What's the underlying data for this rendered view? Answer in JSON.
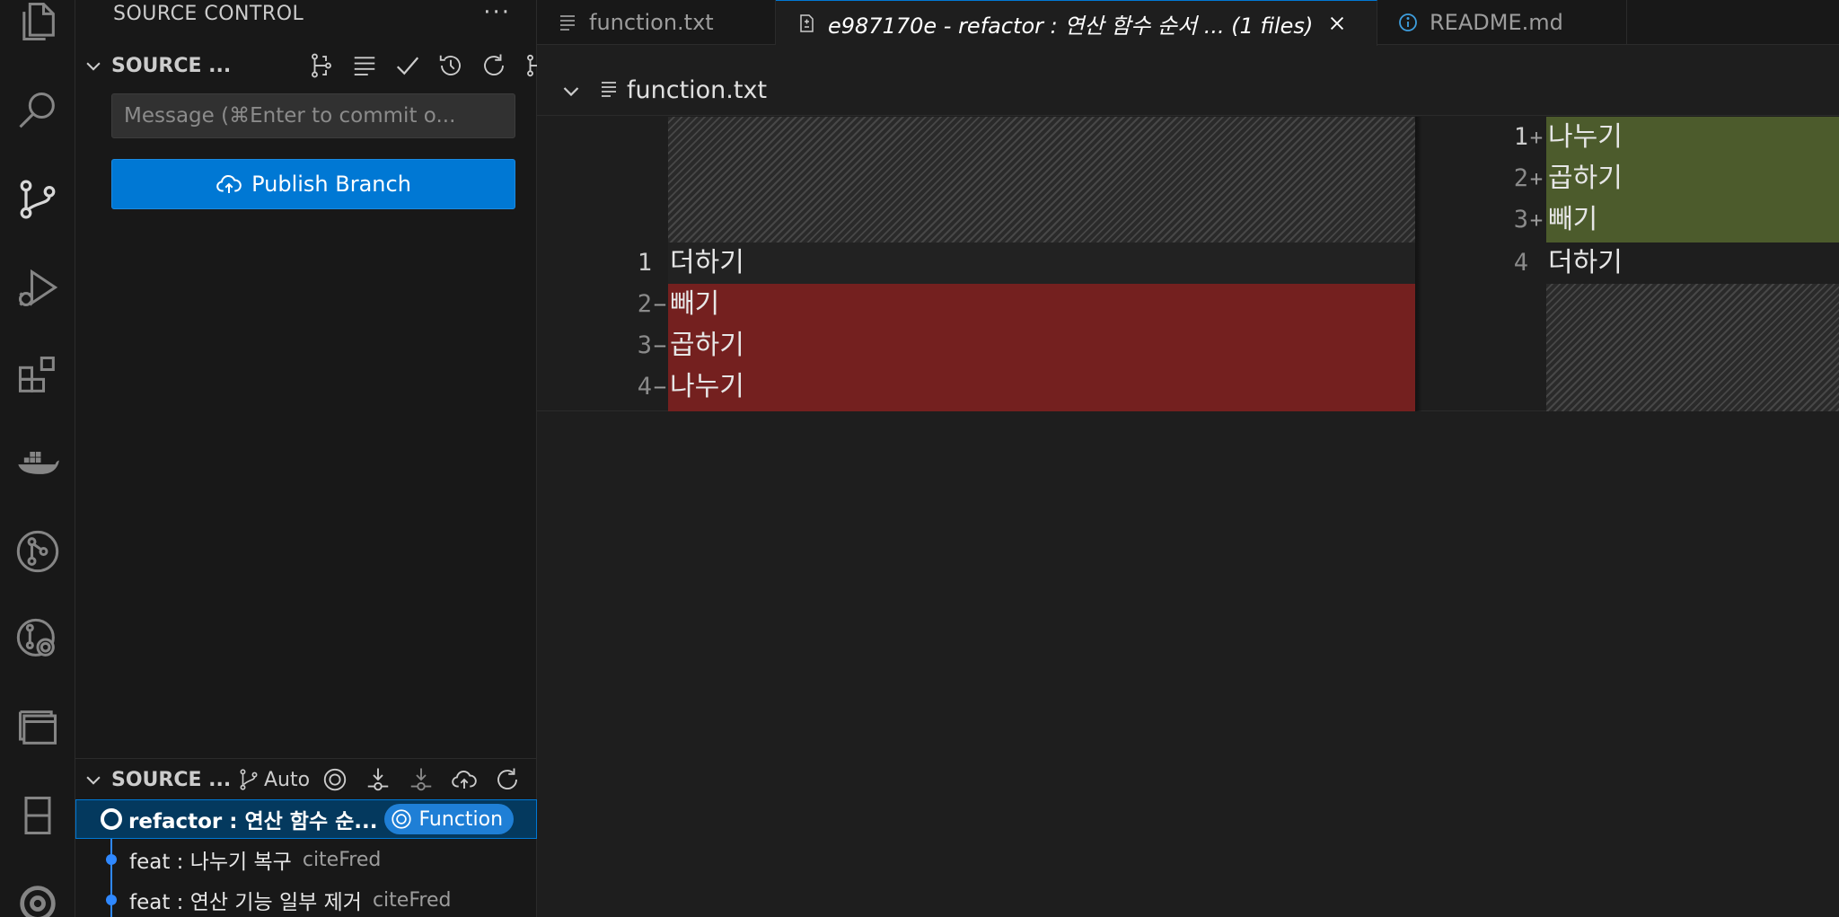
{
  "activity_bar": {
    "icons": [
      "files-icon",
      "search-icon",
      "source-control-icon",
      "run-debug-icon",
      "extensions-icon",
      "docker-icon",
      "git-graph-icon",
      "git-lens-icon",
      "panel-icon",
      "remote-icon",
      "account-icon"
    ]
  },
  "sidebar": {
    "title": "SOURCE CONTROL",
    "more": "···",
    "changes_section": {
      "title": "SOURCE ...",
      "more": "···"
    },
    "commit_input": {
      "placeholder": "Message (⌘Enter to commit o..."
    },
    "publish_button": {
      "label": "Publish Branch"
    },
    "graph_section": {
      "title": "SOURCE ...",
      "auto_label": "Auto"
    },
    "commits": [
      {
        "message": "refactor : 연산 함수 순...",
        "badge": "Function",
        "selected": true
      },
      {
        "message": "feat : 나누기 복구",
        "author": "citeFred"
      },
      {
        "message": "feat : 연산 기능 일부 제거",
        "author": "citeFred"
      }
    ]
  },
  "tabs": [
    {
      "label": "function.txt",
      "active": false
    },
    {
      "label": "e987170e - refactor : 연산 함수 순서 ... (1 files)",
      "active": true
    },
    {
      "label": "README.md",
      "active": false
    }
  ],
  "editor": {
    "file_name": "function.txt",
    "left": [
      {
        "num": "1",
        "marker": "",
        "text": "더하기",
        "type": "context"
      },
      {
        "num": "2",
        "marker": "−",
        "text": "빼기",
        "type": "deleted"
      },
      {
        "num": "3",
        "marker": "−",
        "text": "곱하기",
        "type": "deleted"
      },
      {
        "num": "4",
        "marker": "−",
        "text": "나누기",
        "type": "deleted"
      }
    ],
    "right": [
      {
        "num": "1",
        "marker": "+",
        "text": "나누기",
        "type": "added"
      },
      {
        "num": "2",
        "marker": "+",
        "text": "곱하기",
        "type": "added"
      },
      {
        "num": "3",
        "marker": "+",
        "text": "빼기",
        "type": "added"
      },
      {
        "num": "4",
        "marker": "",
        "text": "더하기",
        "type": "context"
      }
    ]
  },
  "colors": {
    "accent": "#0078d4",
    "deleted_bg": "#74201f",
    "added_bg": "#4c5b2c",
    "graph_blue": "#2f88ff"
  }
}
